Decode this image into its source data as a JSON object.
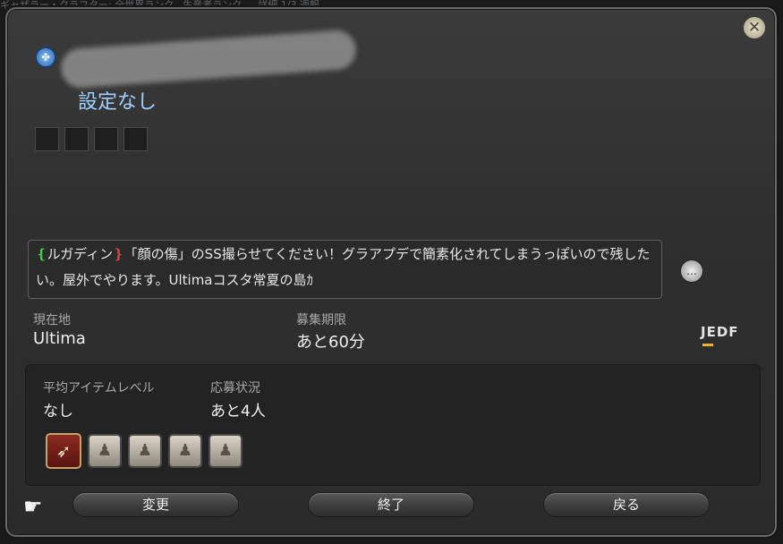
{
  "background_text": "ギャザラー・クラフター: 全世界ランク、生産者ランク … 詳細  1/3 週報",
  "window": {
    "close_icon": "close-x-icon",
    "pf_icon": "party-finder-icon",
    "setting_label": "設定なし"
  },
  "comment": {
    "bracket_left": "❴",
    "auto_tl": "ルガディン",
    "bracket_right": "❵",
    "text": "「顔の傷」のSS撮らせてください！グラアプデで簡素化されてしまうっぽいので残したい。屋外でやります。Ultimaコスタ常夏の島ｶ",
    "speech_icon": "speech-bubble-icon"
  },
  "info": {
    "location_label": "現在地",
    "location_value": "Ultima",
    "deadline_label": "募集期限",
    "deadline_value": "あと60分",
    "language_tag": "JEDF"
  },
  "panel": {
    "ilvl_label": "平均アイテムレベル",
    "ilvl_value": "なし",
    "status_label": "応募状況",
    "status_value": "あと4人",
    "slots": [
      {
        "type": "filled",
        "icon": "leader-job-icon",
        "glyph": "➶"
      },
      {
        "type": "open",
        "icon": "empty-slot-icon",
        "glyph": "♟"
      },
      {
        "type": "open",
        "icon": "empty-slot-icon",
        "glyph": "♟"
      },
      {
        "type": "open",
        "icon": "empty-slot-icon",
        "glyph": "♟"
      },
      {
        "type": "open",
        "icon": "empty-slot-icon",
        "glyph": "♟"
      }
    ]
  },
  "buttons": {
    "change": "変更",
    "end": "終了",
    "back": "戻る"
  },
  "cursor_icon": "hand-pointer-icon"
}
